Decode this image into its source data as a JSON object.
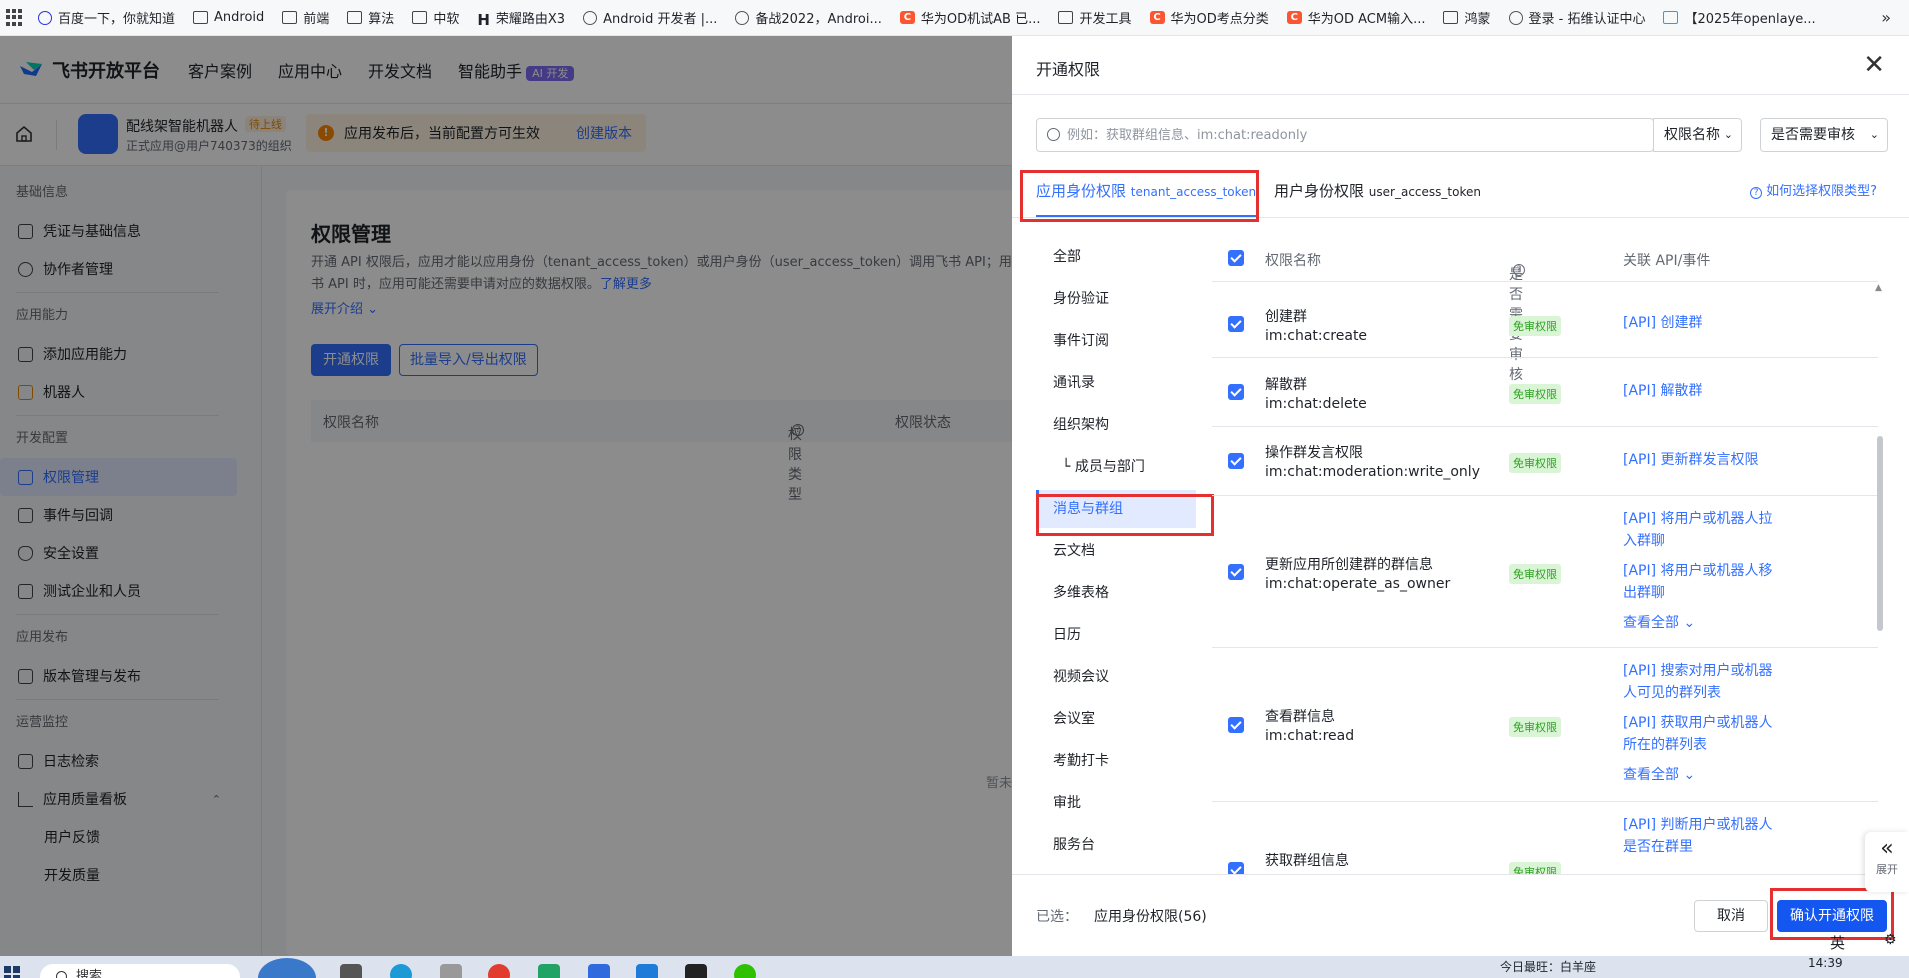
{
  "bookmarks": [
    {
      "icon": "baidu-paw-icon",
      "label": "百度一下，你就知道"
    },
    {
      "icon": "folder-icon",
      "label": "Android"
    },
    {
      "icon": "folder-icon",
      "label": "前端"
    },
    {
      "icon": "folder-icon",
      "label": "算法"
    },
    {
      "icon": "folder-icon",
      "label": "中软"
    },
    {
      "icon": "h-logo-icon",
      "label": "荣耀路由X3"
    },
    {
      "icon": "globe-icon",
      "label": "Android 开发者 |..."
    },
    {
      "icon": "globe-icon",
      "label": "备战2022，Androi..."
    },
    {
      "icon": "csdn-icon",
      "label": "华为OD机试AB 已..."
    },
    {
      "icon": "folder-icon",
      "label": "开发工具"
    },
    {
      "icon": "csdn-icon",
      "label": "华为OD考点分类"
    },
    {
      "icon": "csdn-icon",
      "label": "华为OD ACM输入..."
    },
    {
      "icon": "folder-icon",
      "label": "鸿蒙"
    },
    {
      "icon": "globe-icon",
      "label": "登录 - 拓维认证中心"
    },
    {
      "icon": "tv-icon",
      "label": "【2025年openlaye..."
    }
  ],
  "bookmarks_more": "»",
  "nav": {
    "brand": "飞书开放平台",
    "items": [
      "客户案例",
      "应用中心",
      "开发文档",
      "智能助手"
    ],
    "ai_badge": "AI 开发"
  },
  "appbar": {
    "app_name": "配线架智能机器人",
    "status": "待上线",
    "subtitle": "正式应用@用户740373的组织",
    "notice": "应用发布后，当前配置方可生效",
    "notice_link": "创建版本",
    "warn_glyph": "!"
  },
  "sidebar": {
    "groups": [
      {
        "title": "基础信息",
        "items": [
          "凭证与基础信息",
          "协作者管理"
        ]
      },
      {
        "title": "应用能力",
        "items": [
          "添加应用能力",
          "机器人"
        ]
      },
      {
        "title": "开发配置",
        "items": [
          "权限管理",
          "事件与回调",
          "安全设置",
          "测试企业和人员"
        ]
      },
      {
        "title": "应用发布",
        "items": [
          "版本管理与发布"
        ]
      },
      {
        "title": "运营监控",
        "items": [
          "日志检索",
          "应用质量看板"
        ]
      }
    ],
    "sub_items": [
      "用户反馈",
      "开发质量"
    ],
    "active": "权限管理",
    "chevron": "⌃"
  },
  "content": {
    "title": "权限管理",
    "desc": "开通 API 权限后，应用才能以应用身份（tenant_access_token）或用户身份（user_access_token）调用飞书 API；用飞书 API 时，应用可能还需要申请对应的数据权限。",
    "learn_more": "了解更多",
    "expand": "展开介绍 ⌄",
    "btn_open": "开通权限",
    "btn_batch": "批量导入/导出权限",
    "col_name": "权限名称",
    "col_type": "权限类型",
    "col_status": "权限状态",
    "empty": "暂未"
  },
  "drawer": {
    "title": "开通权限",
    "close": "✕",
    "search_placeholder": "例如：获取群组信息、im:chat:readonly",
    "dropdown_name": "权限名称",
    "dropdown_review": "是否需要审核",
    "chevron": "⌄",
    "tab_app": "应用身份权限",
    "tab_app_token": "tenant_access_token",
    "tab_user": "用户身份权限",
    "tab_user_token": "user_access_token",
    "help": "如何选择权限类型?",
    "help_glyph": "?",
    "categories": [
      "全部",
      "身份验证",
      "事件订阅",
      "通讯录",
      "组织架构",
      "└ 成员与部门",
      "消息与群组",
      "云文档",
      "多维表格",
      "日历",
      "视频会议",
      "会议室",
      "考勤打卡",
      "审批",
      "服务台"
    ],
    "active_category": "消息与群组",
    "col_name": "权限名称",
    "col_review": "是否需要审核",
    "col_api": "关联 API/事件",
    "rows": [
      {
        "name": "创建群",
        "id": "im:chat:create",
        "tag": "免审权限",
        "apis": [
          "[API] 创建群"
        ],
        "see_all": ""
      },
      {
        "name": "解散群",
        "id": "im:chat:delete",
        "tag": "免审权限",
        "apis": [
          "[API] 解散群"
        ],
        "see_all": ""
      },
      {
        "name": "操作群发言权限",
        "id": "im:chat:moderation:write_only",
        "tag": "免审权限",
        "apis": [
          "[API] 更新群发言权限"
        ],
        "see_all": ""
      },
      {
        "name": "更新应用所创建群的群信息",
        "id": "im:chat:operate_as_owner",
        "tag": "免审权限",
        "apis": [
          "[API] 将用户或机器人拉入群聊",
          "[API] 将用户或机器人移出群聊"
        ],
        "see_all": "查看全部 ⌄"
      },
      {
        "name": "查看群信息",
        "id": "im:chat:read",
        "tag": "免审权限",
        "apis": [
          "[API] 搜索对用户或机器人可见的群列表",
          "[API] 获取用户或机器人所在的群列表"
        ],
        "see_all": "查看全部 ⌄"
      },
      {
        "name": "获取群组信息",
        "id": "",
        "tag": "免审权限",
        "apis": [
          "[API] 判断用户或机器人是否在群里"
        ],
        "see_all": ""
      }
    ],
    "selected_label": "已选：",
    "selected_value": "应用身份权限(56)",
    "cancel": "取消",
    "confirm": "确认开通权限",
    "expand_side": "展开",
    "expand_chevrons": "«",
    "scroll_up": "▲"
  },
  "ime": {
    "label": "英",
    "gear": "⚙"
  },
  "taskbar": {
    "search": "搜索",
    "tray": "今日最旺：白羊座",
    "time": "14:39"
  },
  "colors": {
    "accent": "#3370ff",
    "highlight": "#e53030",
    "free_tag": "#2ea121"
  }
}
